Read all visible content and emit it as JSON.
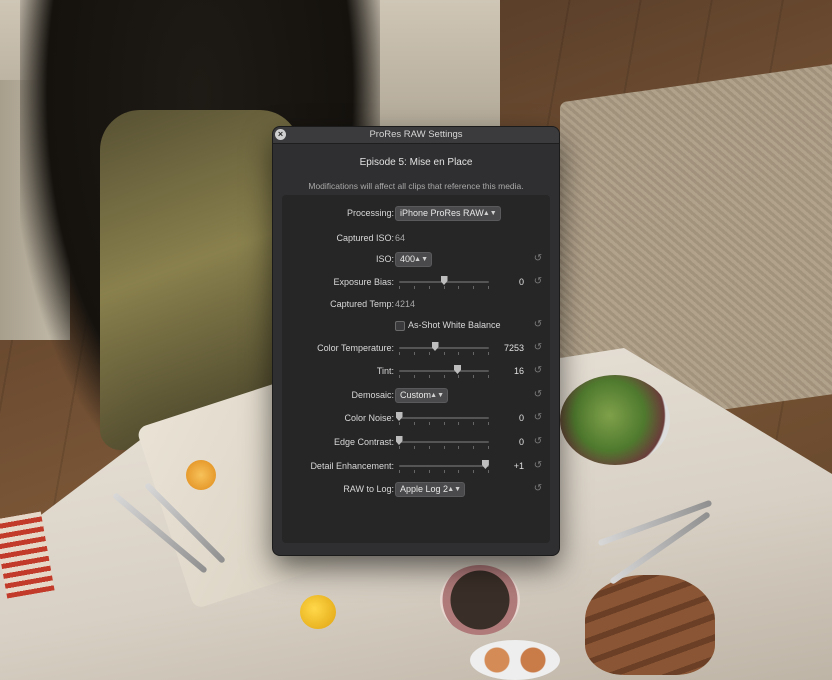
{
  "dialog": {
    "title": "ProRes RAW Settings",
    "subtitle": "Episode 5: Mise en Place",
    "note": "Modifications will affect all clips that reference this media."
  },
  "fields": {
    "processing": {
      "label": "Processing:",
      "value": "iPhone ProRes RAW"
    },
    "captured_iso": {
      "label": "Captured ISO:",
      "value": "64"
    },
    "iso": {
      "label": "ISO:",
      "value": "400"
    },
    "exposure_bias": {
      "label": "Exposure Bias:",
      "value": "0",
      "position": 0.5
    },
    "captured_temp": {
      "label": "Captured Temp:",
      "value": "4214"
    },
    "as_shot": {
      "label": "As-Shot White Balance",
      "checked": false
    },
    "color_temperature": {
      "label": "Color Temperature:",
      "value": "7253",
      "position": 0.4
    },
    "tint": {
      "label": "Tint:",
      "value": "16",
      "position": 0.65
    },
    "demosaic": {
      "label": "Demosaic:",
      "value": "Custom"
    },
    "color_noise": {
      "label": "Color Noise:",
      "value": "0",
      "position": 0.0
    },
    "edge_contrast": {
      "label": "Edge Contrast:",
      "value": "0",
      "position": 0.0
    },
    "detail_enhancement": {
      "label": "Detail Enhancement:",
      "value": "+1",
      "position": 0.96
    },
    "raw_to_log": {
      "label": "RAW to Log:",
      "value": "Apple Log 2"
    }
  },
  "icons": {
    "close": "×",
    "reset": "↺",
    "chevron": "⌃⌄"
  }
}
